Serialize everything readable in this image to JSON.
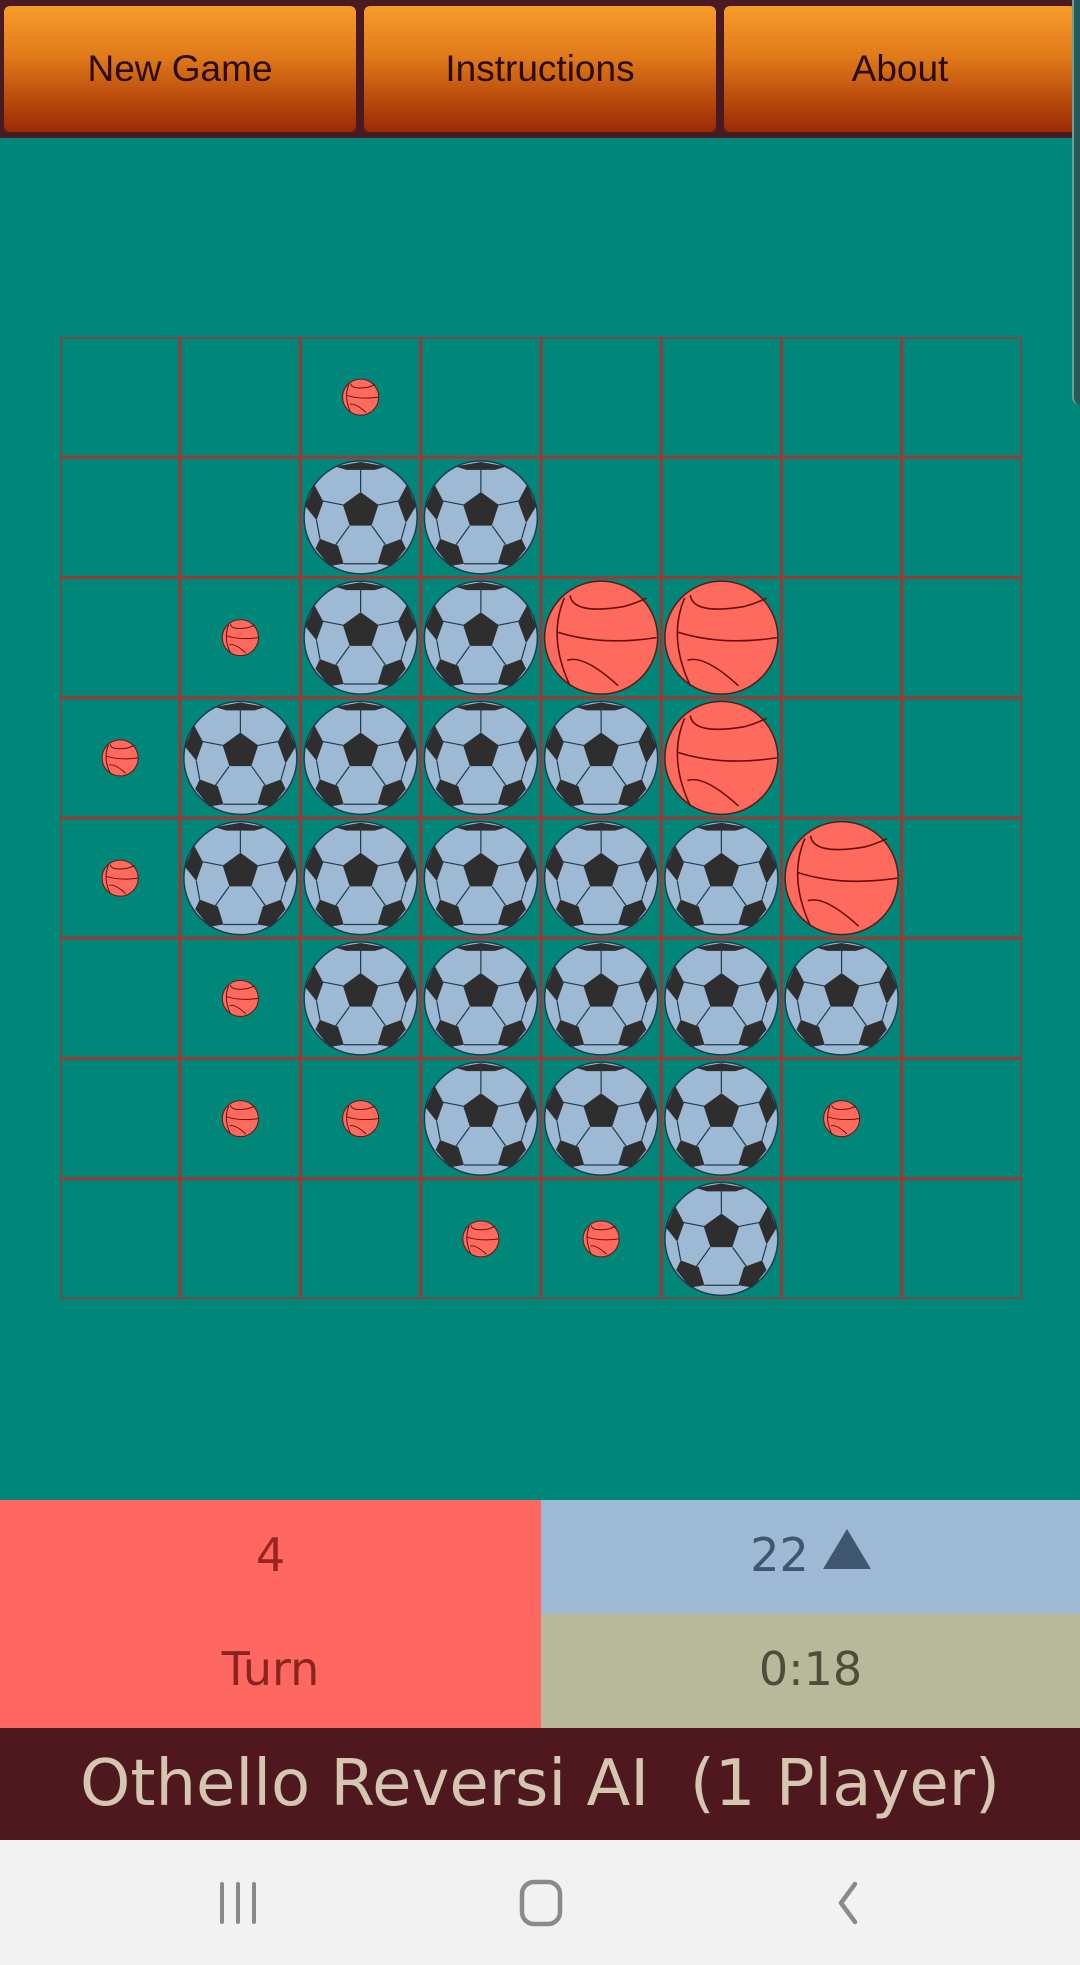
{
  "toolbar": {
    "new_game_label": "New Game",
    "instructions_label": "Instructions",
    "about_label": "About"
  },
  "board": {
    "size": 8,
    "cells": [
      [
        "",
        "",
        "h",
        "",
        "",
        "",
        "",
        ""
      ],
      [
        "",
        "",
        "S",
        "S",
        "",
        "",
        "",
        ""
      ],
      [
        "",
        "h",
        "S",
        "S",
        "B",
        "B",
        "",
        ""
      ],
      [
        "h",
        "S",
        "S",
        "S",
        "S",
        "B",
        "",
        ""
      ],
      [
        "h",
        "S",
        "S",
        "S",
        "S",
        "S",
        "B",
        ""
      ],
      [
        "",
        "h",
        "S",
        "S",
        "S",
        "S",
        "S",
        ""
      ],
      [
        "",
        "h",
        "h",
        "S",
        "S",
        "S",
        "h",
        ""
      ],
      [
        "",
        "",
        "",
        "h",
        "h",
        "S",
        "",
        ""
      ]
    ],
    "legend": {
      "S": "soccer-ball (player 2 piece)",
      "B": "basketball (player 1 piece)",
      "h": "basketball move hint",
      "": "empty"
    }
  },
  "score": {
    "basketball_count": "4",
    "turn_label": "Turn",
    "soccer_count": "22",
    "soccer_indicator_icon": "triangle-up-icon",
    "timer": "0:18"
  },
  "title": "Othello Reversi AI  (1 Player)",
  "colors": {
    "board_bg": "#00877a",
    "grid_line": "#9a3a34",
    "basketball": "#ff6a5e",
    "soccer_light": "#9db9d4",
    "soccer_dark": "#2e2e2e",
    "title_bar": "#4f181e"
  },
  "navbar": {
    "recents_icon": "recent-apps-icon",
    "home_icon": "home-icon",
    "back_icon": "back-icon"
  }
}
